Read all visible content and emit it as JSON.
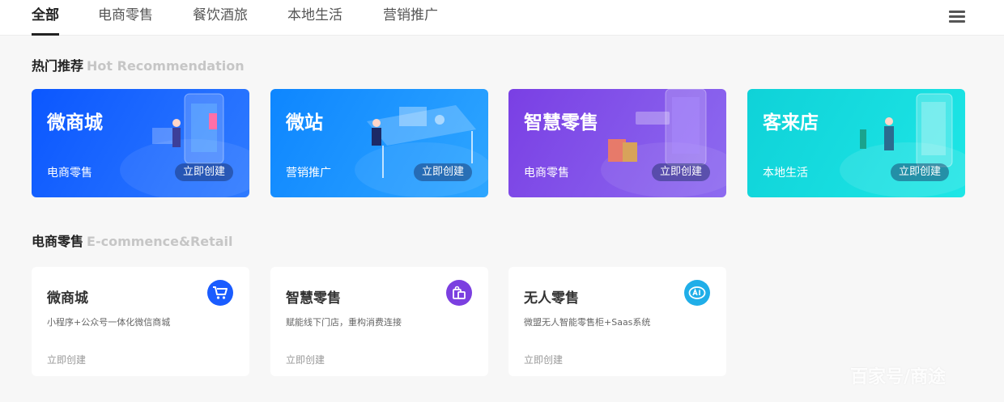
{
  "tabs": [
    {
      "label": "全部",
      "active": true
    },
    {
      "label": "电商零售",
      "active": false
    },
    {
      "label": "餐饮酒旅",
      "active": false
    },
    {
      "label": "本地生活",
      "active": false
    },
    {
      "label": "营销推广",
      "active": false
    }
  ],
  "hot": {
    "title": "热门推荐",
    "subtitle": "Hot Recommendation",
    "cards": [
      {
        "title": "微商城",
        "category": "电商零售",
        "button": "立即创建",
        "color": "#1a5cff"
      },
      {
        "title": "微站",
        "category": "营销推广",
        "button": "立即创建",
        "color": "#1e8ffd"
      },
      {
        "title": "智慧零售",
        "category": "电商零售",
        "button": "立即创建",
        "color": "#7b4fe6"
      },
      {
        "title": "客来店",
        "category": "本地生活",
        "button": "立即创建",
        "color": "#16dadf"
      }
    ]
  },
  "ecommerce": {
    "title": "电商零售",
    "subtitle": "E-commence&Retail",
    "cards": [
      {
        "title": "微商城",
        "desc": "小程序+公众号一体化微信商城",
        "link": "立即创建",
        "icon": "shopping-cart-icon",
        "icon_color": "#1a5cff"
      },
      {
        "title": "智慧零售",
        "desc": "赋能线下门店，重构消费连接",
        "link": "立即创建",
        "icon": "shopping-bags-icon",
        "icon_color": "#7b3fe0"
      },
      {
        "title": "无人零售",
        "desc": "微盟无人智能零售柜+Saas系统",
        "link": "立即创建",
        "icon": "ai-icon",
        "icon_color": "#20aee8"
      }
    ]
  },
  "watermark": "百家号/商途"
}
